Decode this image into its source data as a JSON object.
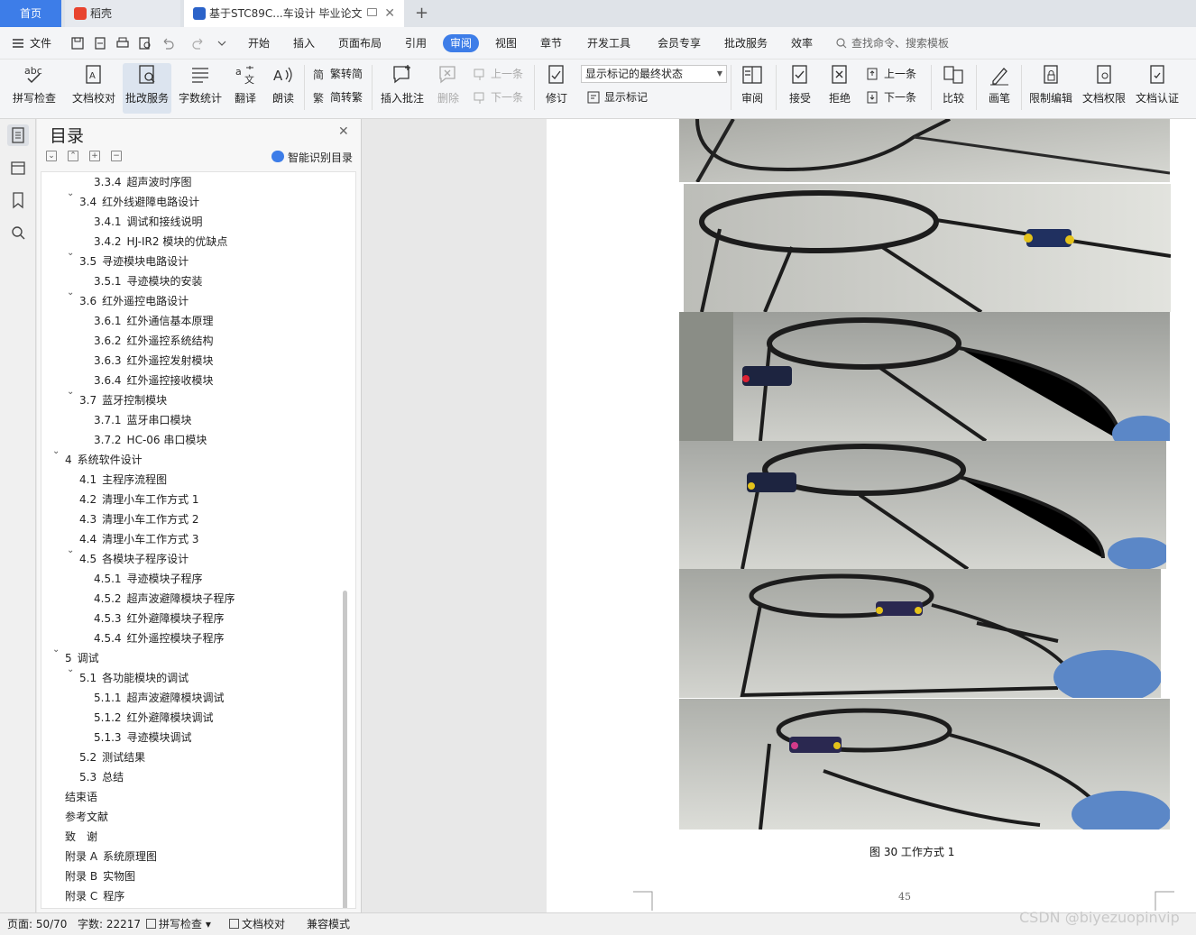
{
  "tabs": {
    "home": "首页",
    "daoke": "稻壳",
    "doc": "基于STC89C...车设计 毕业论文",
    "close": "✕",
    "add": "+"
  },
  "menu": {
    "file": "文件",
    "items": [
      "开始",
      "插入",
      "页面布局",
      "引用",
      "审阅",
      "视图",
      "章节",
      "开发工具",
      "会员专享",
      "批改服务",
      "效率"
    ],
    "active": "审阅",
    "search_placeholder": "查找命令、搜索模板"
  },
  "ribbon": {
    "spell": "拼写检查",
    "proofread": "文档校对",
    "correct": "批改服务",
    "wordcount": "字数统计",
    "translate": "翻译",
    "read": "朗读",
    "trad_to_simp": "繁转简",
    "simp_to_trad": "简转繁",
    "insert_comment": "插入批注",
    "delete": "删除",
    "prev_comment": "上一条",
    "next_comment": "下一条",
    "revise": "修订",
    "markup_state": "显示标记的最终状态",
    "show_markup": "显示标记",
    "review": "审阅",
    "accept": "接受",
    "reject": "拒绝",
    "prev_change": "上一条",
    "next_change": "下一条",
    "compare": "比较",
    "pen": "画笔",
    "restrict_edit": "限制编辑",
    "doc_permission": "文档权限",
    "doc_auth": "文档认证"
  },
  "toc": {
    "title": "目录",
    "smart_label": "智能识别目录",
    "items": [
      {
        "num": "3.3.4",
        "text": "超声波时序图",
        "level": 3,
        "caret": false
      },
      {
        "num": "3.4",
        "text": "红外线避障电路设计",
        "level": 2,
        "caret": true
      },
      {
        "num": "3.4.1",
        "text": "调试和接线说明",
        "level": 3,
        "caret": false
      },
      {
        "num": "3.4.2",
        "text": "HJ-IR2 模块的优缺点",
        "level": 3,
        "caret": false
      },
      {
        "num": "3.5",
        "text": "寻迹模块电路设计",
        "level": 2,
        "caret": true
      },
      {
        "num": "3.5.1",
        "text": "寻迹模块的安装",
        "level": 3,
        "caret": false
      },
      {
        "num": "3.6",
        "text": "红外遥控电路设计",
        "level": 2,
        "caret": true
      },
      {
        "num": "3.6.1",
        "text": "红外通信基本原理",
        "level": 3,
        "caret": false
      },
      {
        "num": "3.6.2",
        "text": "红外遥控系统结构",
        "level": 3,
        "caret": false
      },
      {
        "num": "3.6.3",
        "text": "红外遥控发射模块",
        "level": 3,
        "caret": false
      },
      {
        "num": "3.6.4",
        "text": "红外遥控接收模块",
        "level": 3,
        "caret": false
      },
      {
        "num": "3.7",
        "text": "蓝牙控制模块",
        "level": 2,
        "caret": true
      },
      {
        "num": "3.7.1",
        "text": "蓝牙串口模块",
        "level": 3,
        "caret": false
      },
      {
        "num": "3.7.2",
        "text": "HC-06 串口模块",
        "level": 3,
        "caret": false
      },
      {
        "num": "4",
        "text": "系统软件设计",
        "level": 1,
        "caret": true
      },
      {
        "num": "4.1",
        "text": "主程序流程图",
        "level": 2,
        "caret": false
      },
      {
        "num": "4.2",
        "text": "清理小车工作方式 1",
        "level": 2,
        "caret": false
      },
      {
        "num": "4.3",
        "text": "清理小车工作方式 2",
        "level": 2,
        "caret": false
      },
      {
        "num": "4.4",
        "text": "清理小车工作方式 3",
        "level": 2,
        "caret": false
      },
      {
        "num": "4.5",
        "text": "各模块子程序设计",
        "level": 2,
        "caret": true
      },
      {
        "num": "4.5.1",
        "text": "寻迹模块子程序",
        "level": 3,
        "caret": false
      },
      {
        "num": "4.5.2",
        "text": "超声波避障模块子程序",
        "level": 3,
        "caret": false
      },
      {
        "num": "4.5.3",
        "text": "红外避障模块子程序",
        "level": 3,
        "caret": false
      },
      {
        "num": "4.5.4",
        "text": "红外遥控模块子程序",
        "level": 3,
        "caret": false
      },
      {
        "num": "5",
        "text": "调试",
        "level": 1,
        "caret": true
      },
      {
        "num": "5.1",
        "text": "各功能模块的调试",
        "level": 2,
        "caret": true
      },
      {
        "num": "5.1.1",
        "text": "超声波避障模块调试",
        "level": 3,
        "caret": false
      },
      {
        "num": "5.1.2",
        "text": "红外避障模块调试",
        "level": 3,
        "caret": false
      },
      {
        "num": "5.1.3",
        "text": "寻迹模块调试",
        "level": 3,
        "caret": false
      },
      {
        "num": "5.2",
        "text": "测试结果",
        "level": 2,
        "caret": false
      },
      {
        "num": "5.3",
        "text": "总结",
        "level": 2,
        "caret": false
      },
      {
        "num": "",
        "text": "结束语",
        "level": 0,
        "caret": false
      },
      {
        "num": "",
        "text": "参考文献",
        "level": 0,
        "caret": false
      },
      {
        "num": "",
        "text": "致　谢",
        "level": 0,
        "caret": false
      },
      {
        "num": "附录 A",
        "text": "系统原理图",
        "level": 0,
        "caret": false
      },
      {
        "num": "附录 B",
        "text": "实物图",
        "level": 0,
        "caret": false
      },
      {
        "num": "附录 C",
        "text": "程序",
        "level": 0,
        "caret": false
      }
    ]
  },
  "document": {
    "caption": "图 30  工作方式 1",
    "page_number": "45"
  },
  "status": {
    "page": "页面: 50/70",
    "words": "字数: 22217",
    "spell": "拼写检查",
    "proofread": "文档校对",
    "compat": "兼容模式"
  },
  "watermark": "CSDN @biyezuopinvip",
  "colors": {
    "accent": "#3d7de8",
    "wps_red": "#e8432e",
    "writer_blue": "#2a62c9"
  }
}
